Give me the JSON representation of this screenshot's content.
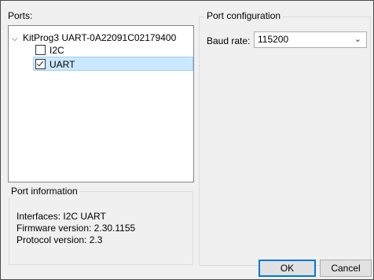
{
  "ports": {
    "label": "Ports:",
    "device": "KitProg3 UART-0A22091C02179400",
    "children": [
      {
        "label": "I2C",
        "checked": false
      },
      {
        "label": "UART",
        "checked": true
      }
    ]
  },
  "port_information": {
    "title": "Port information",
    "interfaces": "Interfaces: I2C UART",
    "firmware": "Firmware version: 2.30.1155",
    "protocol": "Protocol version: 2.3"
  },
  "port_configuration": {
    "title": "Port configuration",
    "baud_label": "Baud rate:",
    "baud_value": "115200"
  },
  "buttons": {
    "ok": "OK",
    "cancel": "Cancel"
  },
  "icons": {
    "expand": "chevron-down-icon",
    "dropdown": "chevron-down-icon"
  }
}
